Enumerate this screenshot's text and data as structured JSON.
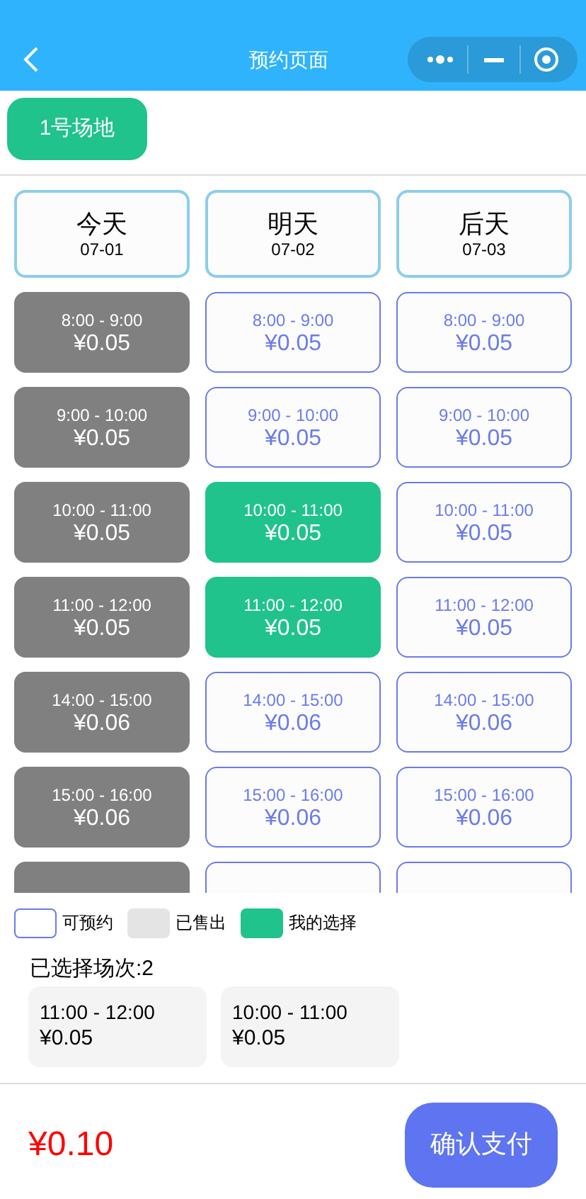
{
  "nav_bar": {
    "title": "预约页面"
  },
  "venues": [
    {
      "label": "1号场地",
      "selected": true
    }
  ],
  "days": [
    {
      "label": "今天",
      "date": "07-01",
      "slots": [
        {
          "time": "8:00 - 9:00",
          "price": "¥0.05",
          "kind": "sold"
        },
        {
          "time": "9:00 - 10:00",
          "price": "¥0.05",
          "kind": "sold"
        },
        {
          "time": "10:00 - 11:00",
          "price": "¥0.05",
          "kind": "sold"
        },
        {
          "time": "11:00 - 12:00",
          "price": "¥0.05",
          "kind": "sold"
        },
        {
          "time": "14:00 - 15:00",
          "price": "¥0.06",
          "kind": "sold"
        },
        {
          "time": "15:00 - 16:00",
          "price": "¥0.06",
          "kind": "sold"
        },
        {
          "kind": "sold"
        }
      ]
    },
    {
      "label": "明天",
      "date": "07-02",
      "slots": [
        {
          "time": "8:00 - 9:00",
          "price": "¥0.05",
          "kind": "available"
        },
        {
          "time": "9:00 - 10:00",
          "price": "¥0.05",
          "kind": "available"
        },
        {
          "time": "10:00 - 11:00",
          "price": "¥0.05",
          "kind": "mine"
        },
        {
          "time": "11:00 - 12:00",
          "price": "¥0.05",
          "kind": "mine"
        },
        {
          "time": "14:00 - 15:00",
          "price": "¥0.06",
          "kind": "available"
        },
        {
          "time": "15:00 - 16:00",
          "price": "¥0.06",
          "kind": "available"
        },
        {
          "kind": "available"
        }
      ]
    },
    {
      "label": "后天",
      "date": "07-03",
      "slots": [
        {
          "time": "8:00 - 9:00",
          "price": "¥0.05",
          "kind": "available"
        },
        {
          "time": "9:00 - 10:00",
          "price": "¥0.05",
          "kind": "available"
        },
        {
          "time": "10:00 - 11:00",
          "price": "¥0.05",
          "kind": "available"
        },
        {
          "time": "11:00 - 12:00",
          "price": "¥0.05",
          "kind": "available"
        },
        {
          "time": "14:00 - 15:00",
          "price": "¥0.06",
          "kind": "available"
        },
        {
          "time": "15:00 - 16:00",
          "price": "¥0.06",
          "kind": "available"
        },
        {
          "kind": "available"
        }
      ]
    }
  ],
  "legend": [
    {
      "label": "可预约",
      "kind": "available"
    },
    {
      "label": "已售出",
      "kind": "sold"
    },
    {
      "label": "我的选择",
      "kind": "mine"
    }
  ],
  "selection": {
    "summary": "已选择场次:2",
    "items": [
      {
        "time": "11:00 - 12:00",
        "price": "¥0.05"
      },
      {
        "time": "10:00 - 11:00",
        "price": "¥0.05"
      }
    ]
  },
  "footer": {
    "total": "¥0.10",
    "pay_button": "确认支付"
  }
}
